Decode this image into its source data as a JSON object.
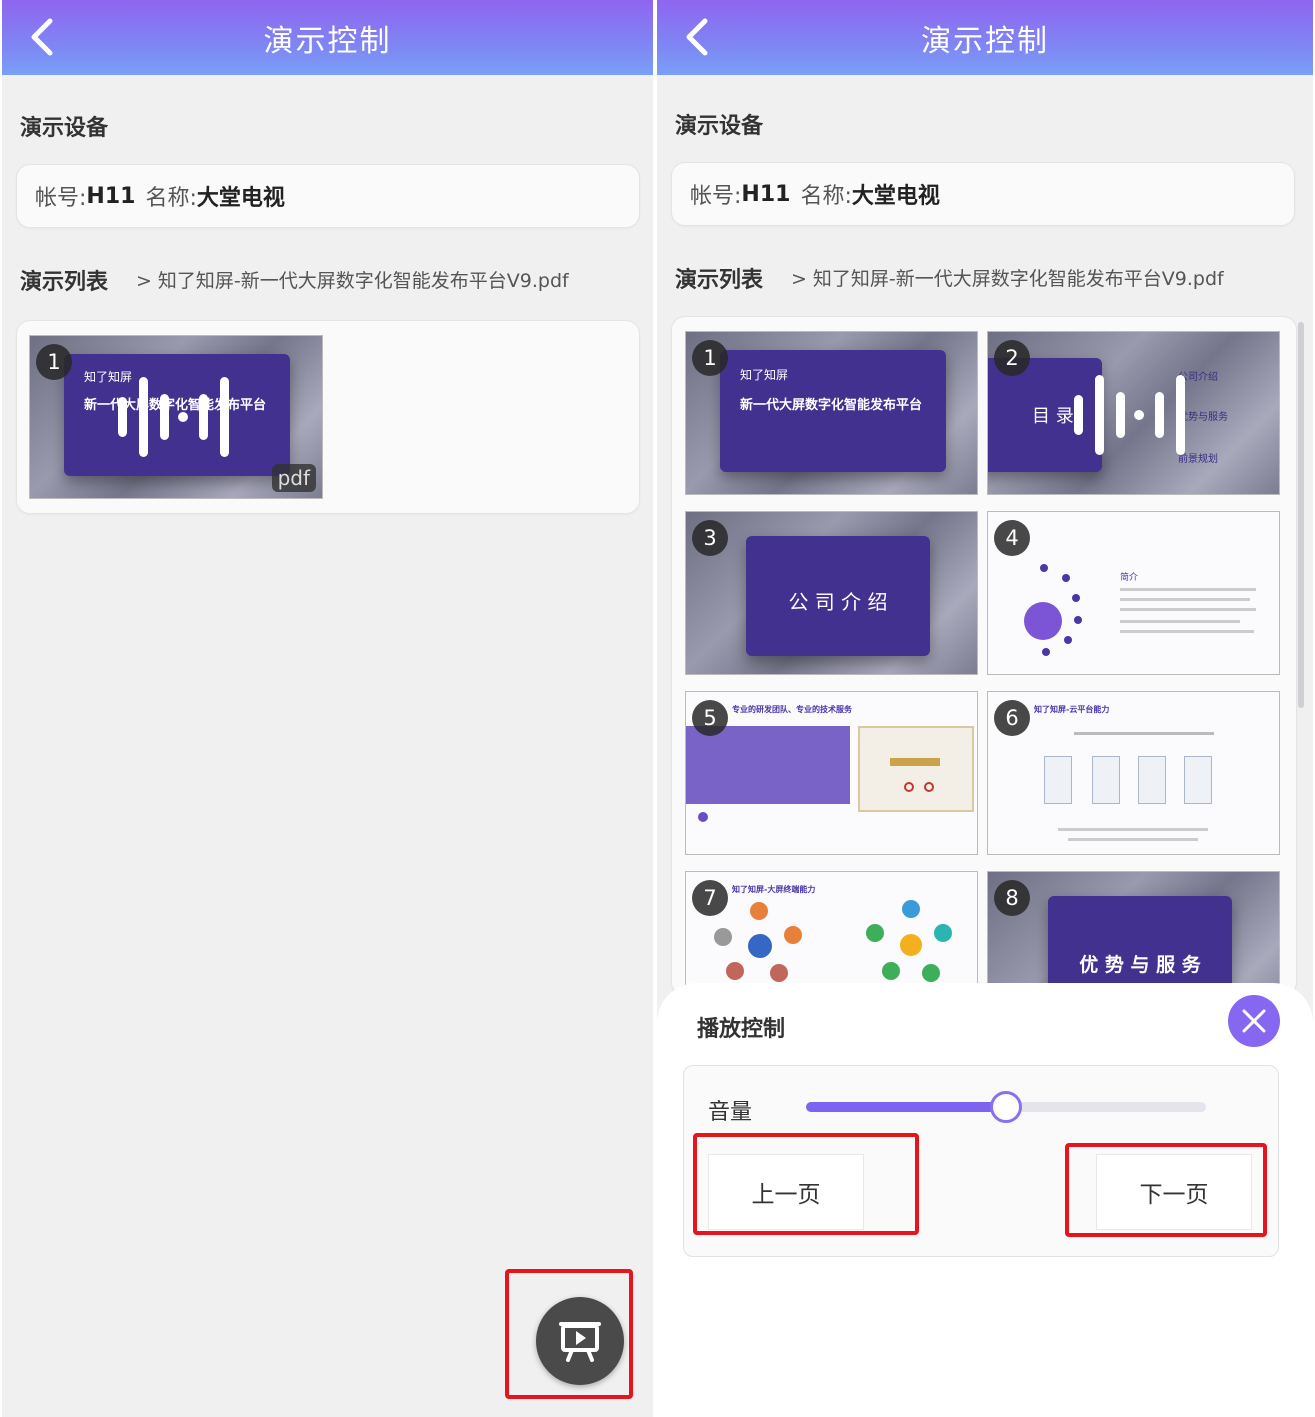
{
  "header": {
    "title": "演示控制"
  },
  "device_section": {
    "title": "演示设备"
  },
  "device": {
    "account_label": "帐号:",
    "account_value": "H11",
    "name_label": "名称:",
    "name_value": "大堂电视"
  },
  "list_section": {
    "title": "演示列表",
    "filename": "知了知屏-新一代大屏数字化智能发布平台V9.pdf"
  },
  "file_tag": "pdf",
  "slides": [
    {
      "number": "1",
      "heading": "知了知屏",
      "subtitle": "新一代大屏数字化智能发布平台"
    },
    {
      "number": "2",
      "heading": "目 录",
      "items": [
        "公司介绍",
        "优势与服务",
        "前景规划"
      ]
    },
    {
      "number": "3",
      "heading": "公 司 介 绍"
    },
    {
      "number": "4",
      "heading": "简介"
    },
    {
      "number": "5",
      "heading": "专业的研发团队、专业的技术服务"
    },
    {
      "number": "6",
      "heading": "知了知屏-云平台能力"
    },
    {
      "number": "7",
      "heading": "知了知屏-大屏终端能力"
    },
    {
      "number": "8",
      "heading": "优 势 与 服 务"
    }
  ],
  "playback": {
    "title": "播放控制",
    "volume_label": "音量",
    "volume": 0.5,
    "prev_label": "上一页",
    "next_label": "下一页"
  },
  "colors": {
    "accent": "#7c63f0",
    "highlight": "#e8141b",
    "slide_purple": "#42318f"
  },
  "icons": [
    "back-icon",
    "audio-wave-icon",
    "presentation-icon",
    "close-icon"
  ]
}
